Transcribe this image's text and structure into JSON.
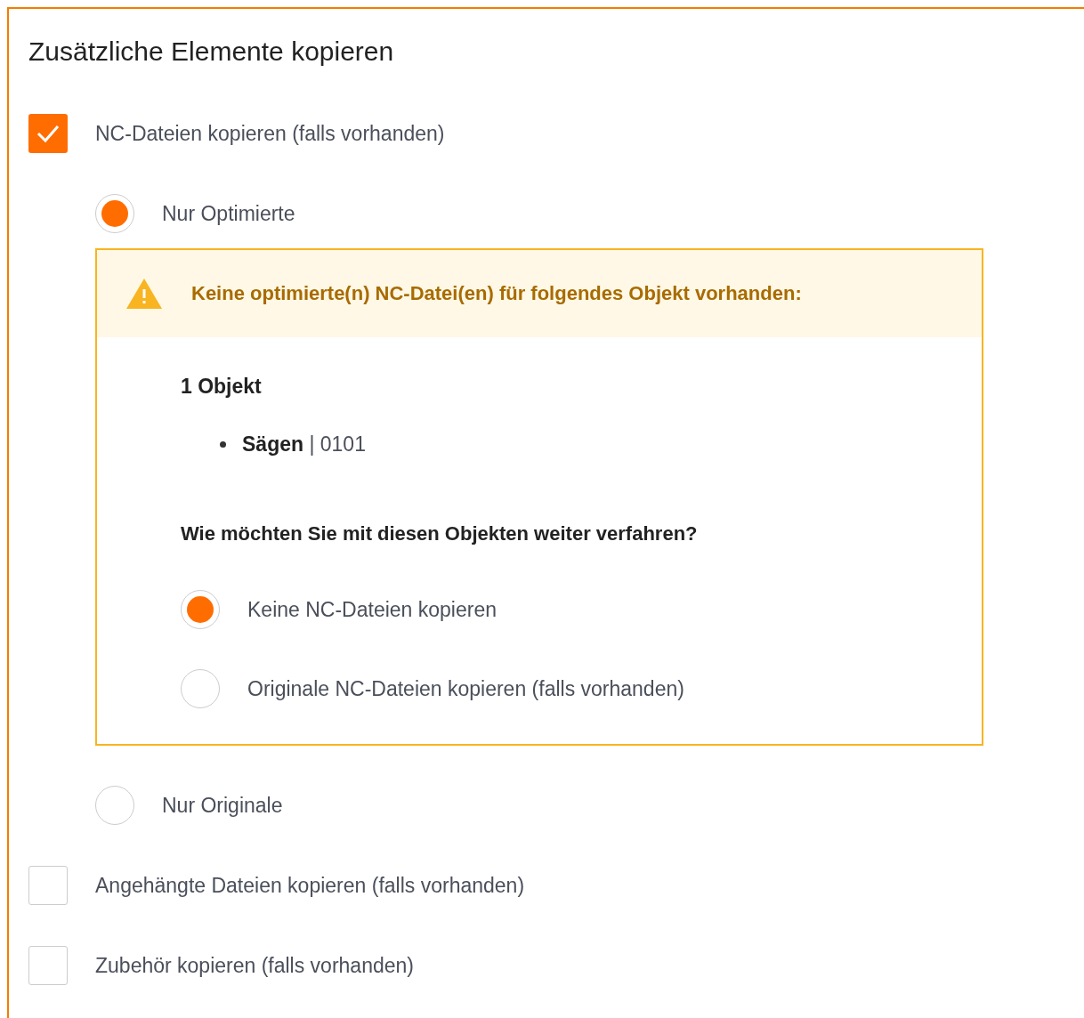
{
  "section": {
    "title": "Zusätzliche Elemente kopieren"
  },
  "options": [
    {
      "label": "NC-Dateien kopieren (falls vorhanden)",
      "checked": true,
      "choices": [
        {
          "label": "Nur Optimierte",
          "selected": true,
          "warning": {
            "message": "Keine optimierte(n) NC-Datei(en) für folgendes Objekt vorhanden:",
            "count": "1 Objekt",
            "items": [
              "**Sägen** | 0101"
            ],
            "question": "Wie möchten Sie mit diesen Objekten weiter verfahren?",
            "choices": [
              {
                "label": "Keine NC-Dateien kopieren",
                "selected": true
              },
              {
                "label": "Originale NC-Dateien kopieren (falls vorhanden)",
                "selected": false
              }
            ]
          }
        },
        {
          "label": "Nur Originale",
          "selected": false
        }
      ]
    },
    {
      "label": "Angehängte Dateien kopieren (falls vorhanden)",
      "checked": false
    },
    {
      "label": "Zubehör kopieren (falls vorhanden)",
      "checked": false
    }
  ]
}
